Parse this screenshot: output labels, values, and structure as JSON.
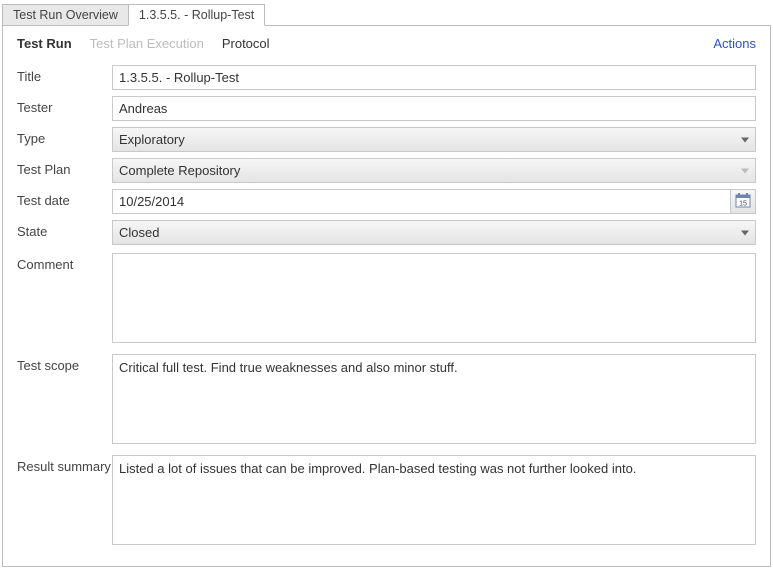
{
  "tabs": {
    "overview": "Test Run Overview",
    "current": "1.3.5.5. - Rollup-Test"
  },
  "subtabs": {
    "testrun": "Test Run",
    "plan_exec": "Test Plan Execution",
    "protocol": "Protocol"
  },
  "actions_label": "Actions",
  "labels": {
    "title": "Title",
    "tester": "Tester",
    "type": "Type",
    "testplan": "Test Plan",
    "testdate": "Test date",
    "state": "State",
    "comment": "Comment",
    "scope": "Test scope",
    "summary": "Result summary"
  },
  "values": {
    "title": "1.3.5.5. - Rollup-Test",
    "tester": "Andreas",
    "type": "Exploratory",
    "testplan": "Complete Repository",
    "testdate": "10/25/2014",
    "state": "Closed",
    "comment": "",
    "scope": "Critical full test. Find true weaknesses and also minor stuff.",
    "summary": "Listed a lot of issues that can be improved. Plan-based testing was not further looked into."
  },
  "calendar_day": "15"
}
